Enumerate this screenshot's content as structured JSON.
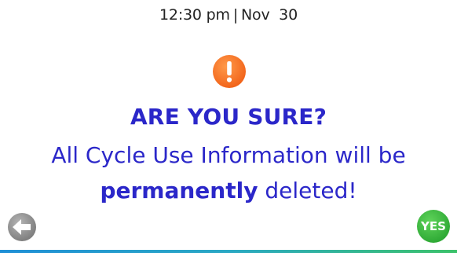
{
  "status": {
    "time": "12:30 pm",
    "separator": "|",
    "date": "Nov  30"
  },
  "dialog": {
    "icon": "warning-exclamation-icon",
    "title": "ARE YOU SURE?",
    "message_line1": "All Cycle Use Information will be",
    "message_bold": "permanently",
    "message_end": " deleted!"
  },
  "actions": {
    "back_icon": "back-arrow-icon",
    "yes_label": "YES"
  },
  "colors": {
    "text_blue": "#2b27c9",
    "warning_orange": "#ff6a1a",
    "yes_green": "#3bbf3f",
    "back_gray": "#8c8c8c"
  }
}
